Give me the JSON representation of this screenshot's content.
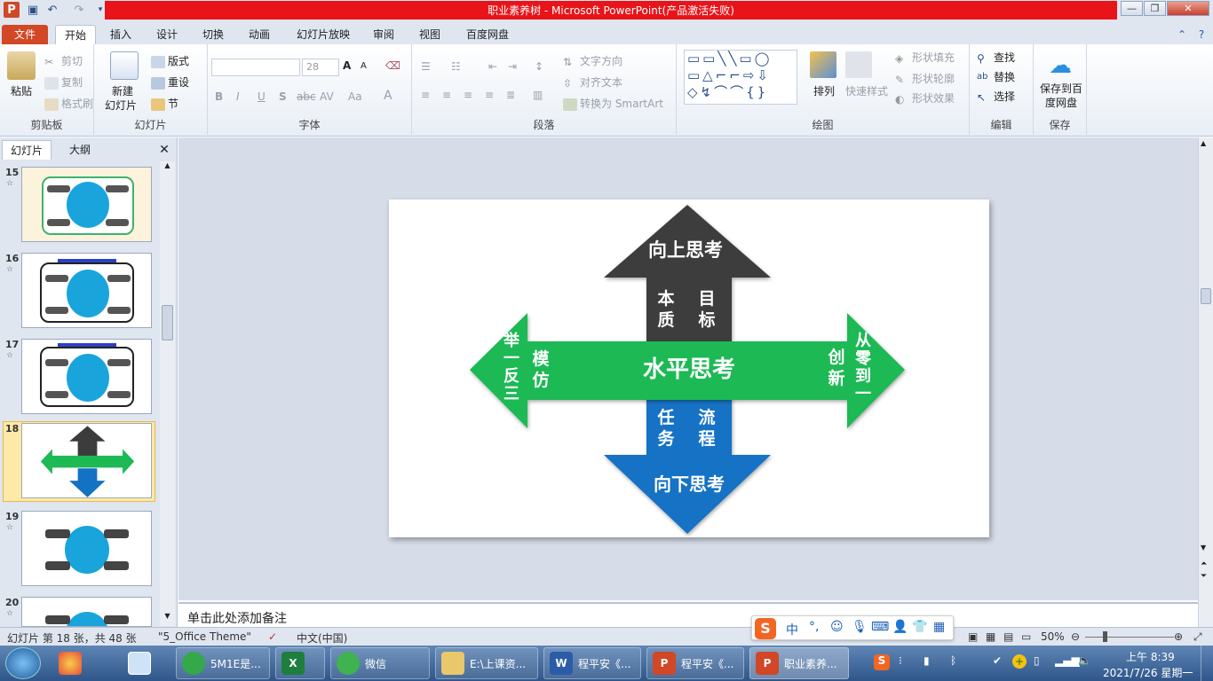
{
  "window": {
    "title": "职业素养树  -  Microsoft PowerPoint(产品激活失败)"
  },
  "tabs": [
    "文件",
    "开始",
    "插入",
    "设计",
    "切换",
    "动画",
    "幻灯片放映",
    "审阅",
    "视图",
    "百度网盘"
  ],
  "ribbon": {
    "clipboard": {
      "label": "剪贴板",
      "paste": "粘贴",
      "cut": "剪切",
      "copy": "复制",
      "format_painter": "格式刷"
    },
    "slides": {
      "label": "幻灯片",
      "new_slide": "新建",
      "new_slide2": "幻灯片",
      "layout": "版式",
      "reset": "重设",
      "section": "节"
    },
    "font": {
      "label": "字体",
      "size": "28",
      "bold": "B",
      "italic": "I",
      "underline": "U",
      "shadow": "S",
      "strike": "abc",
      "spacing": "AV",
      "case": "Aa",
      "grow": "A",
      "shrink": "A",
      "color": "A"
    },
    "paragraph": {
      "label": "段落",
      "text_direction": "文字方向",
      "align_text": "对齐文本",
      "smartart": "转换为 SmartArt"
    },
    "drawing": {
      "label": "绘图",
      "arrange": "排列",
      "quick_styles": "快速样式",
      "shape_fill": "形状填充",
      "shape_outline": "形状轮廓",
      "shape_effects": "形状效果"
    },
    "editing": {
      "label": "编辑",
      "find": "查找",
      "replace": "替换",
      "select": "选择"
    },
    "save": {
      "label": "保存",
      "save_baidu": "保存到百度网盘"
    }
  },
  "left_pane": {
    "tabs": [
      "幻灯片",
      "大纲"
    ],
    "thumbnails": [
      {
        "num": "15"
      },
      {
        "num": "16"
      },
      {
        "num": "17"
      },
      {
        "num": "18"
      },
      {
        "num": "19"
      },
      {
        "num": "20"
      }
    ]
  },
  "slide": {
    "up_title": "向上思考",
    "up_left": "本\n质",
    "up_right": "目\n标",
    "center": "水平思考",
    "left_outer": "举\n一\n反\n三",
    "left_inner": "模\n仿",
    "right_inner": "创\n新",
    "right_outer": "从\n零\n到\n一",
    "down_left": "任\n务",
    "down_right": "流\n程",
    "down_title": "向下思考",
    "colors": {
      "up": "#3c3c3c",
      "horizontal": "#1db954",
      "down": "#1472c4"
    }
  },
  "notes": {
    "placeholder": "单击此处添加备注"
  },
  "status": {
    "slide_info": "幻灯片 第 18 张，共 48 张",
    "theme": "\"5_Office Theme\"",
    "language": "中文(中国)",
    "zoom": "50%"
  },
  "ime": {
    "mode": "中"
  },
  "taskbar": {
    "items": [
      "5M1E是...",
      "",
      "微信",
      "E:\\上课资...",
      "程平安《...",
      "程平安《...",
      "职业素养..."
    ],
    "time": "上午 8:39",
    "date": "2021/7/26 星期一"
  }
}
